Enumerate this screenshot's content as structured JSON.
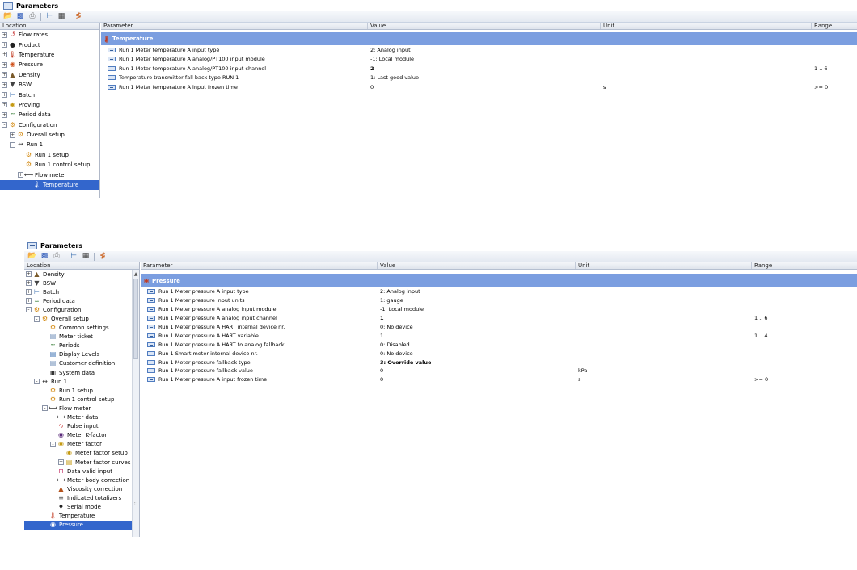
{
  "colors": {
    "group_band": "#7b9ee0",
    "selected_row": "#3366cc"
  },
  "toolbar_icons": [
    "folder-open-icon",
    "save-icon",
    "print-icon",
    "tree-icon",
    "grid-icon",
    "filter-icon"
  ],
  "panel1": {
    "title": "Parameters",
    "tree_header": "Location",
    "columns": {
      "parameter": "Parameter",
      "value": "Value",
      "unit": "Unit",
      "range": "Range"
    },
    "tree": [
      {
        "label": "Flow rates",
        "expander": "+",
        "icon": "flow-rates-icon",
        "indent": 0
      },
      {
        "label": "Product",
        "expander": "+",
        "icon": "product-icon",
        "indent": 0
      },
      {
        "label": "Temperature",
        "expander": "+",
        "icon": "temperature-icon",
        "indent": 0
      },
      {
        "label": "Pressure",
        "expander": "+",
        "icon": "pressure-icon",
        "indent": 0
      },
      {
        "label": "Density",
        "expander": "+",
        "icon": "density-icon",
        "indent": 0
      },
      {
        "label": "BSW",
        "expander": "+",
        "icon": "bsw-icon",
        "indent": 0
      },
      {
        "label": "Batch",
        "expander": "+",
        "icon": "batch-icon",
        "indent": 0
      },
      {
        "label": "Proving",
        "expander": "+",
        "icon": "proving-icon",
        "indent": 0
      },
      {
        "label": "Period data",
        "expander": "+",
        "icon": "period-data-icon",
        "indent": 0
      },
      {
        "label": "Configuration",
        "expander": "-",
        "icon": "configuration-icon",
        "indent": 0
      },
      {
        "label": "Overall setup",
        "expander": "+",
        "icon": "overall-setup-icon",
        "indent": 1
      },
      {
        "label": "Run 1",
        "expander": "-",
        "icon": "run-icon",
        "indent": 1
      },
      {
        "label": "Run 1 setup",
        "expander": "",
        "icon": "run-setup-icon",
        "indent": 2
      },
      {
        "label": "Run 1 control setup",
        "expander": "",
        "icon": "run-control-setup-icon",
        "indent": 2
      },
      {
        "label": "Flow meter",
        "expander": "+",
        "icon": "flow-meter-icon",
        "indent": 2
      },
      {
        "label": "Temperature",
        "expander": "",
        "icon": "temperature-icon",
        "indent": 3,
        "selected": true
      }
    ],
    "group": {
      "label": "Temperature",
      "icon": "temperature-icon"
    },
    "rows": [
      {
        "parameter": "Run 1 Meter temperature A input type",
        "value": "2: Analog input",
        "unit": "",
        "range": "",
        "bold": false
      },
      {
        "parameter": "Run 1 Meter temperature A analog/PT100 input module",
        "value": "-1: Local module",
        "unit": "",
        "range": "",
        "bold": false
      },
      {
        "parameter": "Run 1 Meter temperature A analog/PT100 input channel",
        "value": "2",
        "unit": "",
        "range": "1 .. 6",
        "bold": true
      },
      {
        "parameter": "Temperature transmitter fall back type RUN 1",
        "value": "1: Last good value",
        "unit": "",
        "range": "",
        "bold": false
      },
      {
        "parameter": "Run 1 Meter temperature A input frozen time",
        "value": "0",
        "unit": "s",
        "range": ">= 0",
        "bold": false
      }
    ]
  },
  "panel2": {
    "title": "Parameters",
    "tree_header": "Location",
    "columns": {
      "parameter": "Parameter",
      "value": "Value",
      "unit": "Unit",
      "range": "Range"
    },
    "tree": [
      {
        "label": "Density",
        "expander": "+",
        "icon": "density-icon",
        "indent": 0
      },
      {
        "label": "BSW",
        "expander": "+",
        "icon": "bsw-icon",
        "indent": 0
      },
      {
        "label": "Batch",
        "expander": "+",
        "icon": "batch-icon",
        "indent": 0
      },
      {
        "label": "Period data",
        "expander": "+",
        "icon": "period-data-icon",
        "indent": 0
      },
      {
        "label": "Configuration",
        "expander": "-",
        "icon": "configuration-icon",
        "indent": 0
      },
      {
        "label": "Overall setup",
        "expander": "-",
        "icon": "overall-setup-icon",
        "indent": 1
      },
      {
        "label": "Common settings",
        "expander": "",
        "icon": "common-settings-icon",
        "indent": 2
      },
      {
        "label": "Meter ticket",
        "expander": "",
        "icon": "meter-ticket-icon",
        "indent": 2
      },
      {
        "label": "Periods",
        "expander": "",
        "icon": "periods-icon",
        "indent": 2
      },
      {
        "label": "Display Levels",
        "expander": "",
        "icon": "display-levels-icon",
        "indent": 2
      },
      {
        "label": "Customer definition",
        "expander": "",
        "icon": "customer-definition-icon",
        "indent": 2
      },
      {
        "label": "System data",
        "expander": "",
        "icon": "system-data-icon",
        "indent": 2
      },
      {
        "label": "Run 1",
        "expander": "-",
        "icon": "run-icon",
        "indent": 1
      },
      {
        "label": "Run 1 setup",
        "expander": "",
        "icon": "run-setup-icon",
        "indent": 2
      },
      {
        "label": "Run 1 control setup",
        "expander": "",
        "icon": "run-control-setup-icon",
        "indent": 2
      },
      {
        "label": "Flow meter",
        "expander": "-",
        "icon": "flow-meter-icon",
        "indent": 2
      },
      {
        "label": "Meter data",
        "expander": "",
        "icon": "meter-data-icon",
        "indent": 3
      },
      {
        "label": "Pulse input",
        "expander": "",
        "icon": "pulse-input-icon",
        "indent": 3
      },
      {
        "label": "Meter K-factor",
        "expander": "",
        "icon": "meter-k-factor-icon",
        "indent": 3
      },
      {
        "label": "Meter factor",
        "expander": "-",
        "icon": "meter-factor-icon",
        "indent": 3
      },
      {
        "label": "Meter factor setup",
        "expander": "",
        "icon": "meter-factor-setup-icon",
        "indent": 4
      },
      {
        "label": "Meter factor curves",
        "expander": "+",
        "icon": "meter-factor-curves-icon",
        "indent": 4
      },
      {
        "label": "Data valid input",
        "expander": "",
        "icon": "data-valid-input-icon",
        "indent": 3
      },
      {
        "label": "Meter body correction",
        "expander": "",
        "icon": "meter-body-correction-icon",
        "indent": 3
      },
      {
        "label": "Viscosity correction",
        "expander": "",
        "icon": "viscosity-correction-icon",
        "indent": 3
      },
      {
        "label": "Indicated totalizers",
        "expander": "",
        "icon": "indicated-totalizers-icon",
        "indent": 3
      },
      {
        "label": "Serial mode",
        "expander": "",
        "icon": "serial-mode-icon",
        "indent": 3
      },
      {
        "label": "Temperature",
        "expander": "",
        "icon": "temperature-icon",
        "indent": 2
      },
      {
        "label": "Pressure",
        "expander": "",
        "icon": "pressure-icon",
        "indent": 2,
        "selected": true
      }
    ],
    "group": {
      "label": "Pressure",
      "icon": "pressure-icon"
    },
    "rows": [
      {
        "parameter": "Run 1 Meter pressure A input type",
        "value": "2: Analog input",
        "unit": "",
        "range": "",
        "bold": false
      },
      {
        "parameter": "Run 1 Meter pressure input units",
        "value": "1: gauge",
        "unit": "",
        "range": "",
        "bold": false
      },
      {
        "parameter": "Run 1 Meter pressure A analog input module",
        "value": "-1: Local module",
        "unit": "",
        "range": "",
        "bold": false
      },
      {
        "parameter": "Run 1 Meter pressure A analog input channel",
        "value": "1",
        "unit": "",
        "range": "1 .. 6",
        "bold": true
      },
      {
        "parameter": "Run 1 Meter pressure A HART internal device nr.",
        "value": "0: No device",
        "unit": "",
        "range": "",
        "bold": false
      },
      {
        "parameter": "Run 1 Meter pressure A HART variable",
        "value": "1",
        "unit": "",
        "range": "1 .. 4",
        "bold": false
      },
      {
        "parameter": "Run 1 Meter pressure A HART to analog fallback",
        "value": "0: Disabled",
        "unit": "",
        "range": "",
        "bold": false
      },
      {
        "parameter": "Run 1 Smart meter internal device nr.",
        "value": "0: No device",
        "unit": "",
        "range": "",
        "bold": false
      },
      {
        "parameter": "Run 1 Meter pressure fallback type",
        "value": "3: Override value",
        "unit": "",
        "range": "",
        "bold": true
      },
      {
        "parameter": "Run 1 Meter pressure fallback value",
        "value": "0",
        "unit": "kPa",
        "range": "",
        "bold": false
      },
      {
        "parameter": "Run 1 Meter pressure A input frozen time",
        "value": "0",
        "unit": "s",
        "range": ">= 0",
        "bold": false
      }
    ]
  }
}
